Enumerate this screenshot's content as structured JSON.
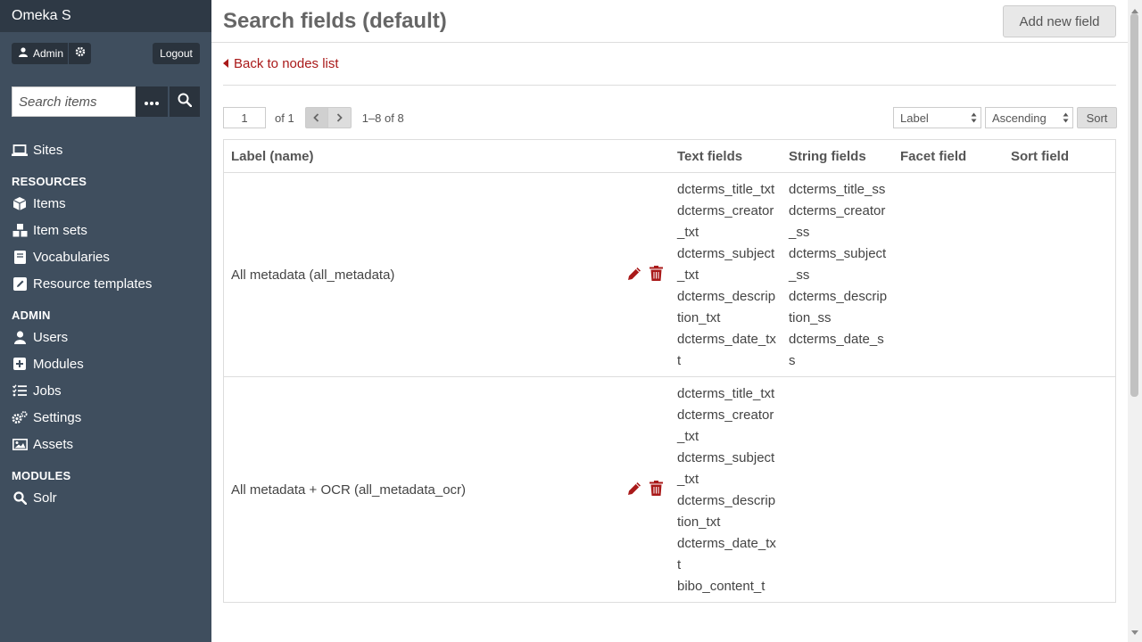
{
  "app": {
    "brand": "Omeka S"
  },
  "user": {
    "name": "Admin",
    "logout": "Logout"
  },
  "search": {
    "placeholder": "Search items"
  },
  "nav": {
    "sites": "Sites",
    "resources_head": "RESOURCES",
    "items": "Items",
    "item_sets": "Item sets",
    "vocabularies": "Vocabularies",
    "resource_templates": "Resource templates",
    "admin_head": "ADMIN",
    "users": "Users",
    "modules": "Modules",
    "jobs": "Jobs",
    "settings": "Settings",
    "assets": "Assets",
    "modules_head": "MODULES",
    "solr": "Solr"
  },
  "header": {
    "title": "Search fields (default)",
    "add_button": "Add new field"
  },
  "back_link": "Back to nodes list",
  "pagination": {
    "page": "1",
    "of": "of 1",
    "range": "1–8 of 8"
  },
  "sorting": {
    "sort_by": "Label",
    "order": "Ascending",
    "sort_button": "Sort"
  },
  "table": {
    "headers": {
      "label": "Label (name)",
      "text_fields": "Text fields",
      "string_fields": "String fields",
      "facet_field": "Facet field",
      "sort_field": "Sort field"
    },
    "rows": [
      {
        "label": "All metadata (all_metadata)",
        "text_fields": [
          "dcterms_title_txt",
          "dcterms_creator_txt",
          "dcterms_subject_txt",
          "dcterms_description_txt",
          "dcterms_date_txt"
        ],
        "string_fields": [
          "dcterms_title_ss",
          "dcterms_creator_ss",
          "dcterms_subject_ss",
          "dcterms_description_ss",
          "dcterms_date_ss"
        ],
        "facet_field": "",
        "sort_field": ""
      },
      {
        "label": "All metadata + OCR (all_metadata_ocr)",
        "text_fields": [
          "dcterms_title_txt",
          "dcterms_creator_txt",
          "dcterms_subject_txt",
          "dcterms_description_txt",
          "dcterms_date_txt",
          "bibo_content_t"
        ],
        "string_fields": [],
        "facet_field": "",
        "sort_field": ""
      }
    ]
  },
  "colors": {
    "sidebar": "#3f4e5e",
    "brand_bar": "#2e3945",
    "link": "#a91919"
  }
}
